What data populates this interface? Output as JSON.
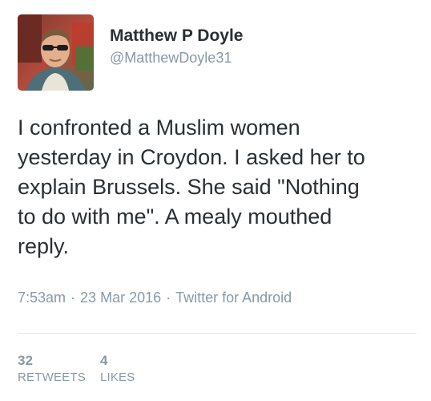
{
  "user": {
    "display_name": "Matthew P Doyle",
    "screen_name": "@MatthewDoyle31"
  },
  "tweet": {
    "text": "I confronted a Muslim women\nyesterday in Croydon. I asked her to\nexplain Brussels. She said \"Nothing\nto do with me\". A mealy mouthed\nreply."
  },
  "meta": {
    "time": "7:53am",
    "separator": "·",
    "date": "23 Mar 2016",
    "source": "Twitter for Android"
  },
  "stats": {
    "retweets": {
      "count": "32",
      "label": "RETWEETS"
    },
    "likes": {
      "count": "4",
      "label": "LIKES"
    }
  },
  "colors": {
    "text": "#292f33",
    "secondary": "#8899a6",
    "divider": "#e1e8ed"
  }
}
